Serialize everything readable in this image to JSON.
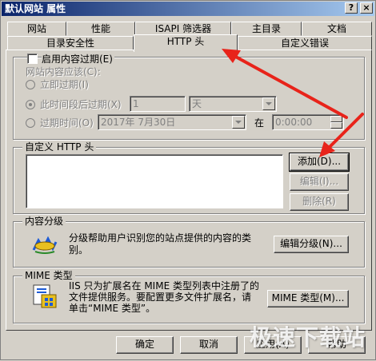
{
  "window": {
    "title": "默认网站 属性",
    "help_btn": "?",
    "close_btn": "×"
  },
  "tabs_row1": [
    "网站",
    "性能",
    "ISAPI 筛选器",
    "主目录",
    "文档"
  ],
  "tabs_row2": [
    "目录安全性",
    "HTTP 头",
    "自定义错误"
  ],
  "content_expiry": {
    "checkbox_label": "启用内容过期(E)",
    "should_label": "网站内容应该(C):",
    "immediate": "立即过期(I)",
    "after_label": "此时间段后过期(X)",
    "after_value": "1",
    "after_unit": "天",
    "at_label": "过期时间(O)",
    "at_date": "2017年 7月30日",
    "at_word": "在",
    "at_time": "0:00:00"
  },
  "custom_http": {
    "legend": "自定义 HTTP 头",
    "add": "添加(D)...",
    "edit": "编辑(I)...",
    "delete": "删除(R)"
  },
  "ratings": {
    "legend": "内容分级",
    "text": "分级帮助用户识别您的站点提供的内容的类别。",
    "edit": "编辑分级(N)..."
  },
  "mime": {
    "legend": "MIME 类型",
    "text": "IIS 只为扩展名在 MIME 类型列表中注册了的文件提供服务。要配置更多文件扩展名，请单击“MIME 类型”。",
    "button": "MIME 类型(M)..."
  },
  "footer": {
    "ok": "确定",
    "cancel": "取消",
    "apply": "应用(A)",
    "help": "帮助"
  },
  "watermark": "极速下载站",
  "annotation_color": "#e8231a",
  "icons": [
    "help-icon",
    "close-icon",
    "ratings-icon",
    "mime-icon",
    "arrow-annotation"
  ]
}
